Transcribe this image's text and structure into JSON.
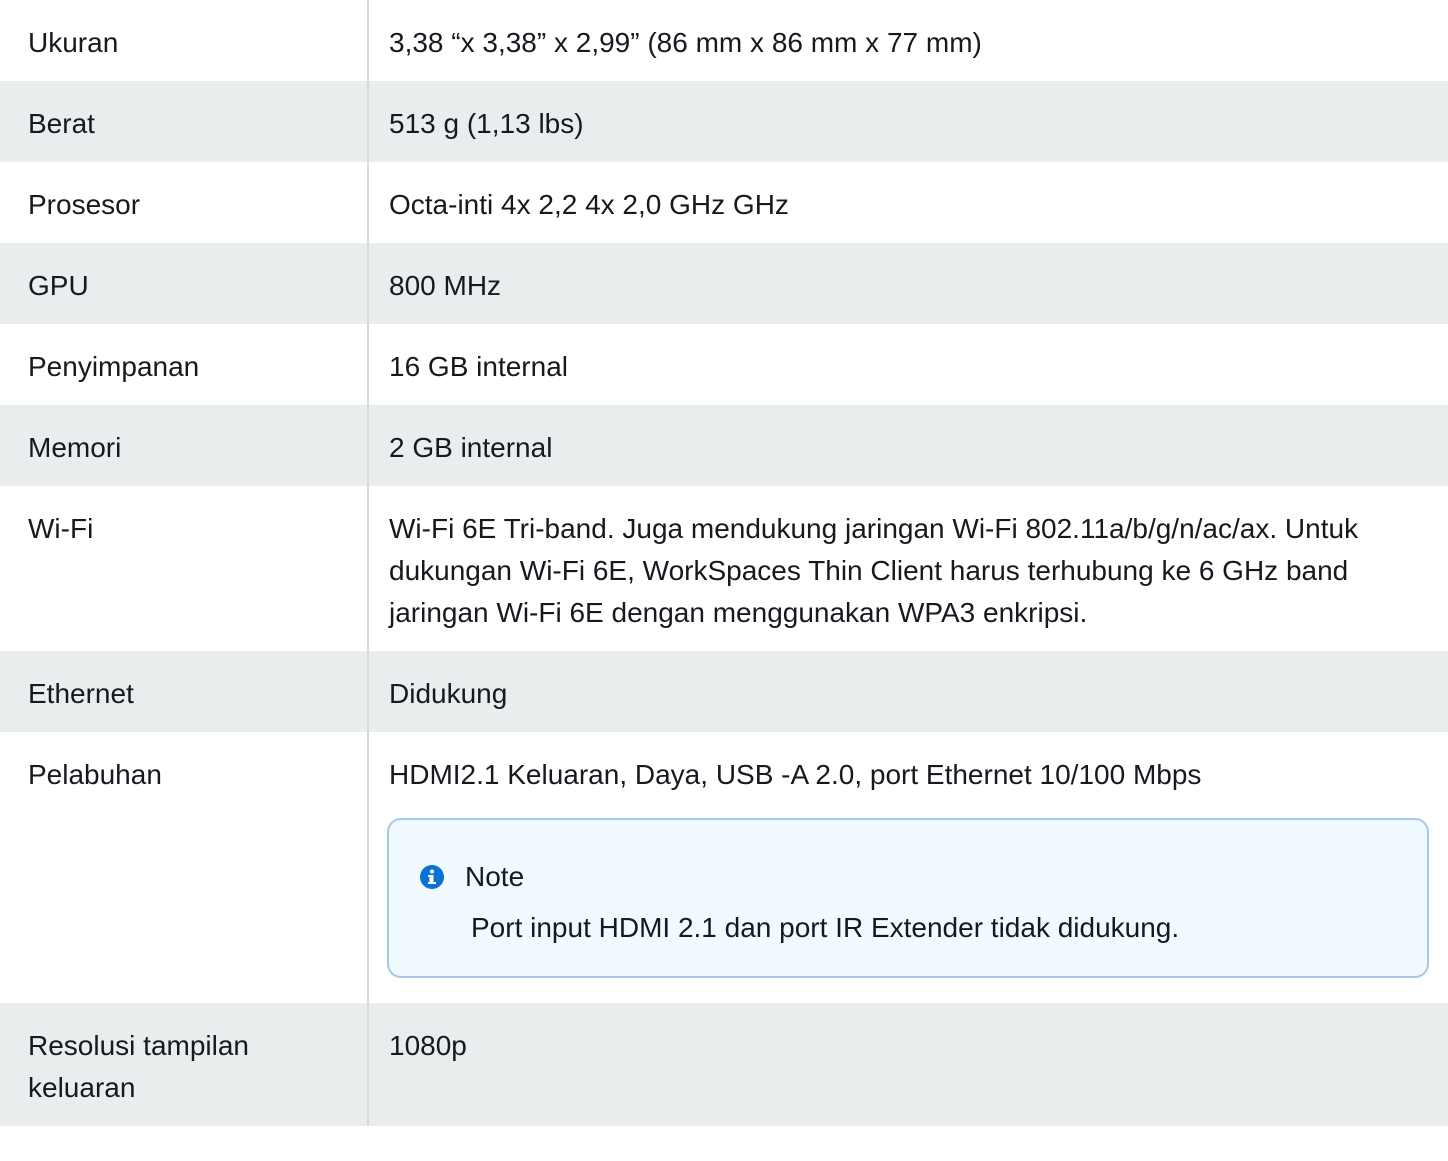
{
  "rows": [
    {
      "label": "Ukuran",
      "value": "3,38 “x 3,38” x 2,99” (86 mm x 86 mm x 77 mm)"
    },
    {
      "label": "Berat",
      "value": "513 g (1,13 lbs)"
    },
    {
      "label": "Prosesor",
      "value": "Octa-inti 4x 2,2 4x 2,0 GHz GHz"
    },
    {
      "label": "GPU",
      "value": "800 MHz"
    },
    {
      "label": "Penyimpanan",
      "value": "16 GB internal"
    },
    {
      "label": "Memori",
      "value": "2 GB internal"
    },
    {
      "label": "Wi-Fi",
      "value": "Wi-Fi 6E Tri-band. Juga mendukung jaringan Wi-Fi 802.11a/b/g/n/ac/ax. Untuk dukungan Wi-Fi 6E, WorkSpaces Thin Client harus terhubung ke 6 GHz band jaringan Wi-Fi 6E dengan menggunakan WPA3 enkripsi."
    },
    {
      "label": "Ethernet",
      "value": "Didukung"
    },
    {
      "label": "Pelabuhan",
      "value": "HDMI2.1 Keluaran, Daya, USB -A 2.0, port Ethernet 10/100 Mbps"
    },
    {
      "label": "Resolusi tampilan keluaran",
      "value": "1080p"
    }
  ],
  "note": {
    "title": "Note",
    "text": "Port input HDMI 2.1 dan port IR Extender tidak didukung.",
    "icon": "info-icon"
  },
  "colors": {
    "row_shade": "#eaeded",
    "note_border": "#a8c8e8",
    "note_background": "#f1faff",
    "info_icon": "#0972d3"
  }
}
